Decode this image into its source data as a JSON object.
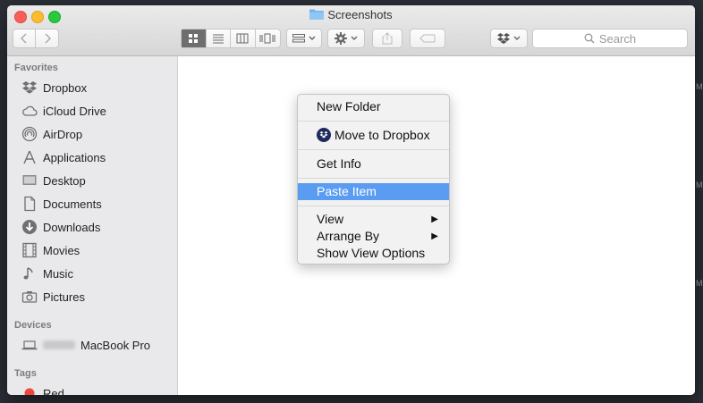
{
  "window": {
    "title": "Screenshots"
  },
  "toolbar": {
    "back_icon": "chevron-left-icon",
    "forward_icon": "chevron-right-icon",
    "view_modes": [
      "icon-view",
      "list-view",
      "column-view",
      "cover-flow-view"
    ],
    "search_placeholder": "Search"
  },
  "sidebar": {
    "favorites_header": "Favorites",
    "favorites": [
      {
        "label": "Dropbox",
        "icon": "dropbox-icon"
      },
      {
        "label": "iCloud Drive",
        "icon": "cloud-icon"
      },
      {
        "label": "AirDrop",
        "icon": "airdrop-icon"
      },
      {
        "label": "Applications",
        "icon": "applications-icon"
      },
      {
        "label": "Desktop",
        "icon": "desktop-icon"
      },
      {
        "label": "Documents",
        "icon": "documents-icon"
      },
      {
        "label": "Downloads",
        "icon": "downloads-icon"
      },
      {
        "label": "Movies",
        "icon": "film-icon"
      },
      {
        "label": "Music",
        "icon": "music-note-icon"
      },
      {
        "label": "Pictures",
        "icon": "camera-icon"
      }
    ],
    "devices_header": "Devices",
    "devices": [
      {
        "label": "MacBook Pro",
        "icon": "laptop-icon"
      }
    ],
    "tags_header": "Tags",
    "tags": [
      {
        "label": "Red",
        "color": "#f0463e"
      }
    ]
  },
  "context_menu": {
    "new_folder": "New Folder",
    "move_to_dropbox": "Move to Dropbox",
    "get_info": "Get Info",
    "paste_item": "Paste Item",
    "view": "View",
    "arrange_by": "Arrange By",
    "show_view_options": "Show View Options",
    "highlight_color": "#5a9cf2"
  }
}
